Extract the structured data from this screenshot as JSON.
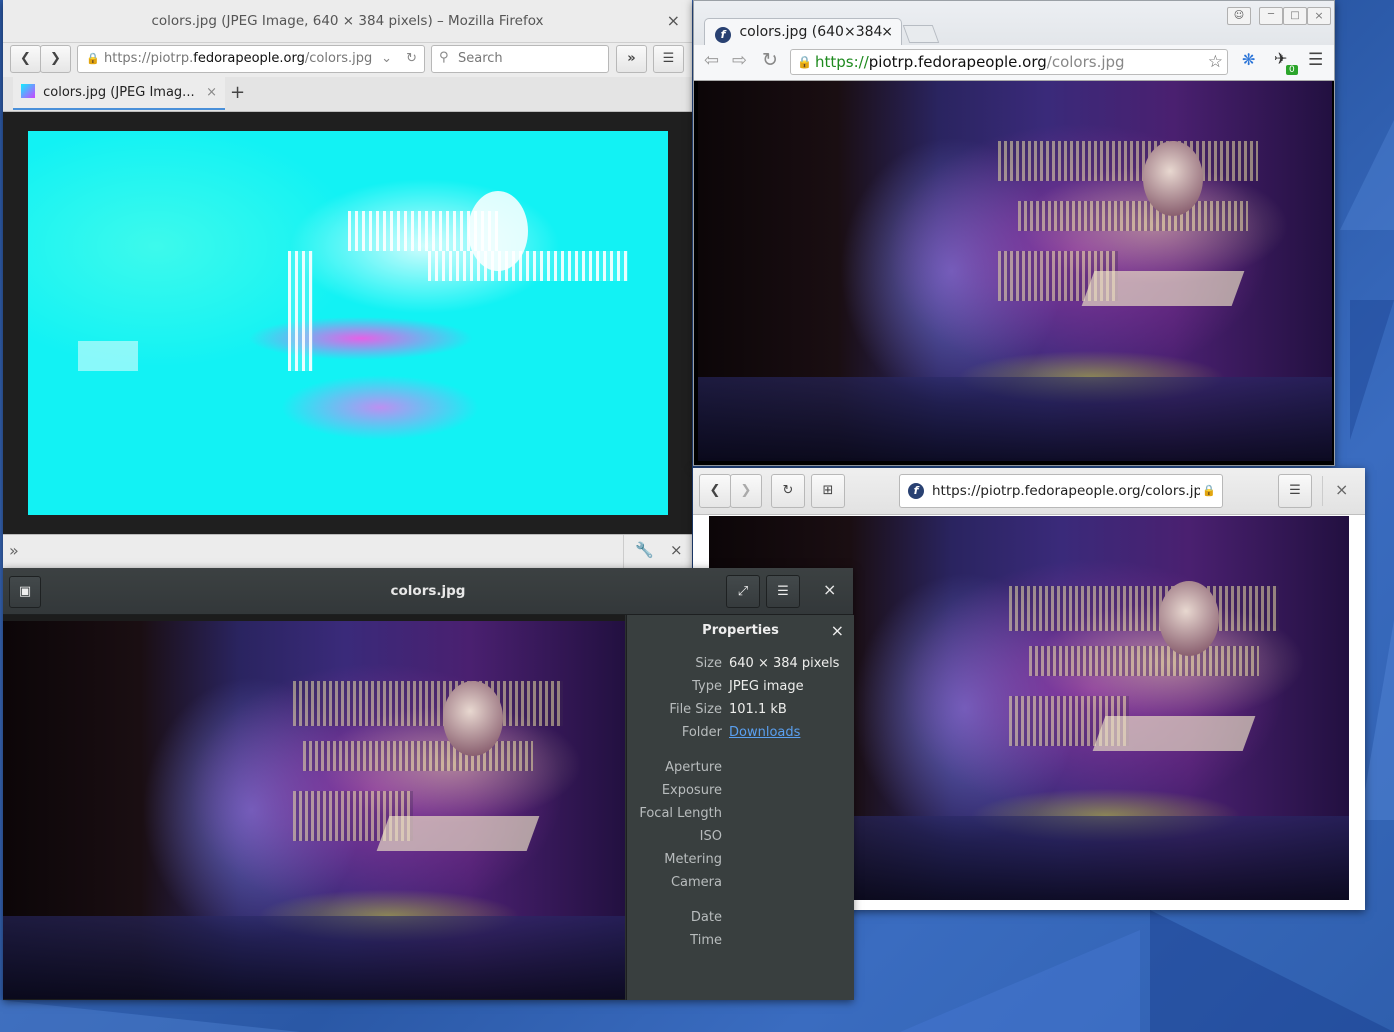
{
  "desktop": {
    "accent": "#2f5fae"
  },
  "firefox": {
    "window_title": "colors.jpg (JPEG Image, 640 × 384 pixels) – Mozilla Firefox",
    "url_prefix": "https://piotrp.",
    "url_domain": "fedorapeople.org",
    "url_rest": "/colors.jpg",
    "search_placeholder": "Search",
    "tab_title": "colors.jpg (JPEG Imag...",
    "new_tab_label": "+",
    "close_tab_label": "×",
    "close_label": "×"
  },
  "chrome": {
    "tab_title": "colors.jpg (640×384",
    "tab_close": "×",
    "url_scheme": "https://",
    "url_domain": "piotrp.fedorapeople.org",
    "url_path": "/colors.jpg",
    "badge_count": "0",
    "secure_color": "#1e8a1e"
  },
  "epiphany": {
    "url": "https://piotrp.fedorapeople.org/colors.jp",
    "close_label": "×"
  },
  "viewer": {
    "title": "colors.jpg",
    "close_label": "×",
    "properties": {
      "heading": "Properties",
      "close_label": "×",
      "size_label": "Size",
      "size_value": "640 × 384 pixels",
      "type_label": "Type",
      "type_value": "JPEG image",
      "filesize_label": "File Size",
      "filesize_value": "101.1 kB",
      "folder_label": "Folder",
      "folder_value": "Downloads",
      "aperture_label": "Aperture",
      "exposure_label": "Exposure",
      "focal_label": "Focal Length",
      "iso_label": "ISO",
      "metering_label": "Metering",
      "camera_label": "Camera",
      "date_label": "Date",
      "time_label": "Time",
      "link_color": "#5aa0f0"
    }
  }
}
